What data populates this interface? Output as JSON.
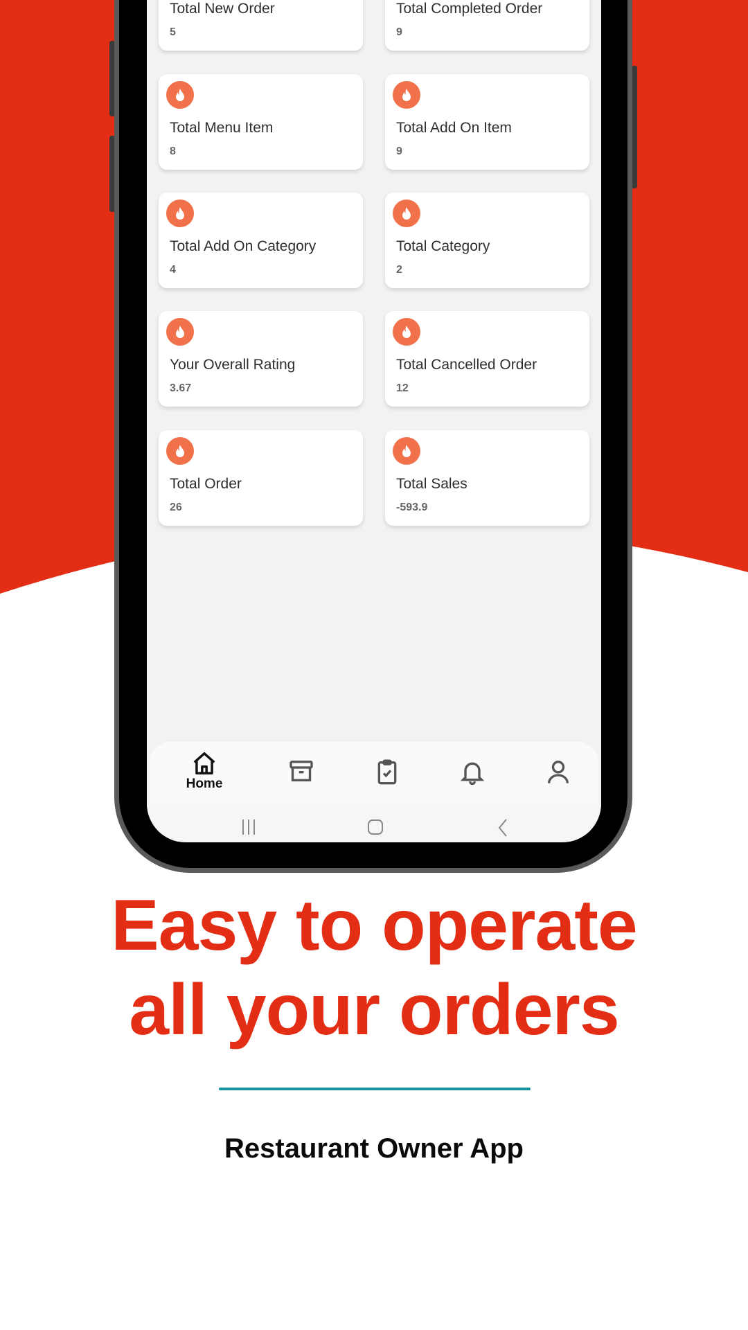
{
  "colors": {
    "brand_red": "#e32d14",
    "icon_orange": "#f0714a",
    "divider_teal": "#14959c"
  },
  "cards": [
    {
      "title": "Total New Order",
      "value": "5",
      "icon": "fire-icon"
    },
    {
      "title": "Total Completed Order",
      "value": "9",
      "icon": "fire-icon"
    },
    {
      "title": "Total Menu Item",
      "value": "8",
      "icon": "fire-icon"
    },
    {
      "title": "Total Add On Item",
      "value": "9",
      "icon": "fire-icon"
    },
    {
      "title": "Total Add On Category",
      "value": "4",
      "icon": "fire-icon"
    },
    {
      "title": "Total Category",
      "value": "2",
      "icon": "fire-icon"
    },
    {
      "title": "Your Overall Rating",
      "value": "3.67",
      "icon": "fire-icon"
    },
    {
      "title": "Total Cancelled Order",
      "value": "12",
      "icon": "fire-icon"
    },
    {
      "title": "Total Order",
      "value": "26",
      "icon": "fire-icon"
    },
    {
      "title": "Total Sales",
      "value": "-593.9",
      "icon": "fire-icon"
    }
  ],
  "bottom_nav": {
    "active": "home",
    "home_label": "Home",
    "items": [
      "home-icon",
      "archive-icon",
      "clipboard-check-icon",
      "bell-icon",
      "user-icon"
    ]
  },
  "promo": {
    "headline_line1": "Easy to operate",
    "headline_line2": "all your orders",
    "subtitle": "Restaurant Owner App"
  }
}
